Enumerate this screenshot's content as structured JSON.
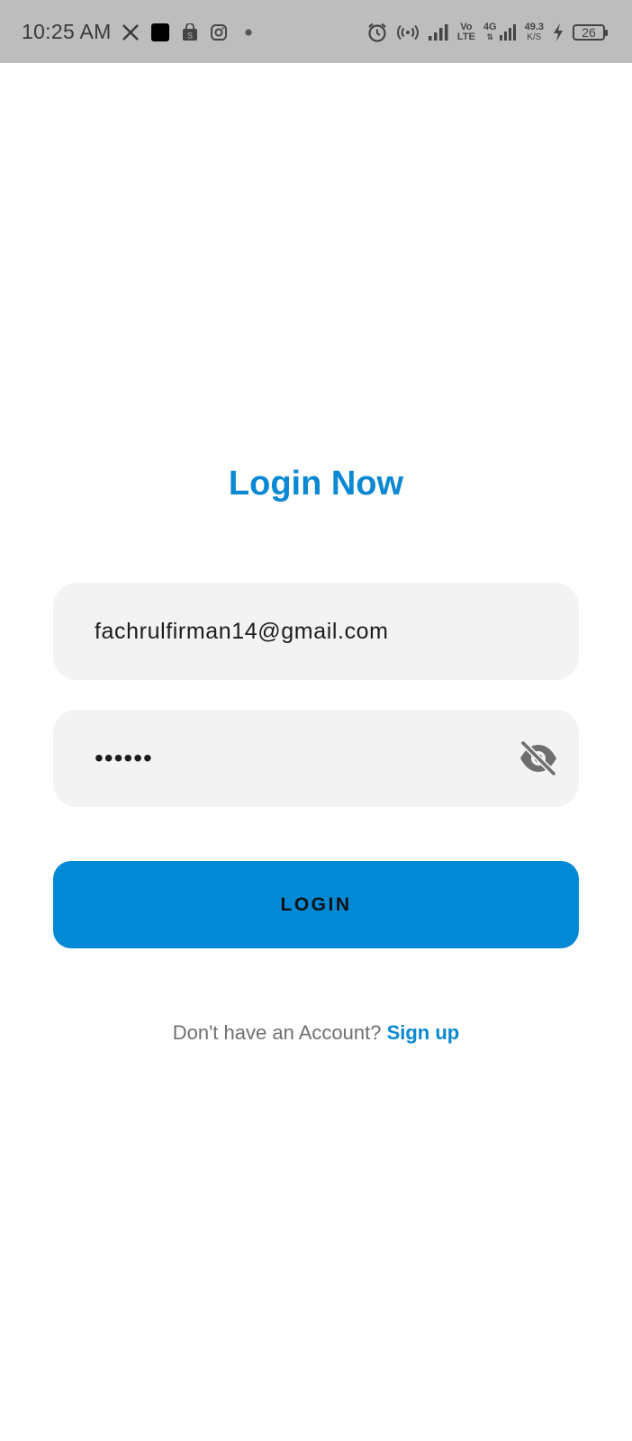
{
  "status_bar": {
    "time": "10:25 AM",
    "net_speed_value": "49.3",
    "net_speed_unit": "K/S",
    "battery_level": "26",
    "left_icons": [
      "x-app-icon",
      "black-app-icon",
      "shop-bag-icon",
      "instagram-icon",
      "dot-icon"
    ],
    "right_icons": [
      "alarm-icon",
      "hotspot-icon",
      "signal-icon",
      "volte-icon",
      "4g-signal-icon",
      "charging-icon",
      "battery-icon"
    ],
    "volte_label_top": "Vo",
    "volte_label_bottom": "LTE",
    "network_label": "4G"
  },
  "login": {
    "title": "Login Now",
    "email_value": "fachrulfirman14@gmail.com",
    "password_masked": "••••••",
    "password_toggle_icon": "eye-off-icon",
    "button_label": "LOGIN",
    "signup_prompt": "Don't have an Account?",
    "signup_link": "Sign up"
  },
  "colors": {
    "accent": "#0a88d3",
    "button": "#0289d6",
    "field_bg": "#f3f3f3",
    "status_bar_bg": "#bdbdbd"
  }
}
